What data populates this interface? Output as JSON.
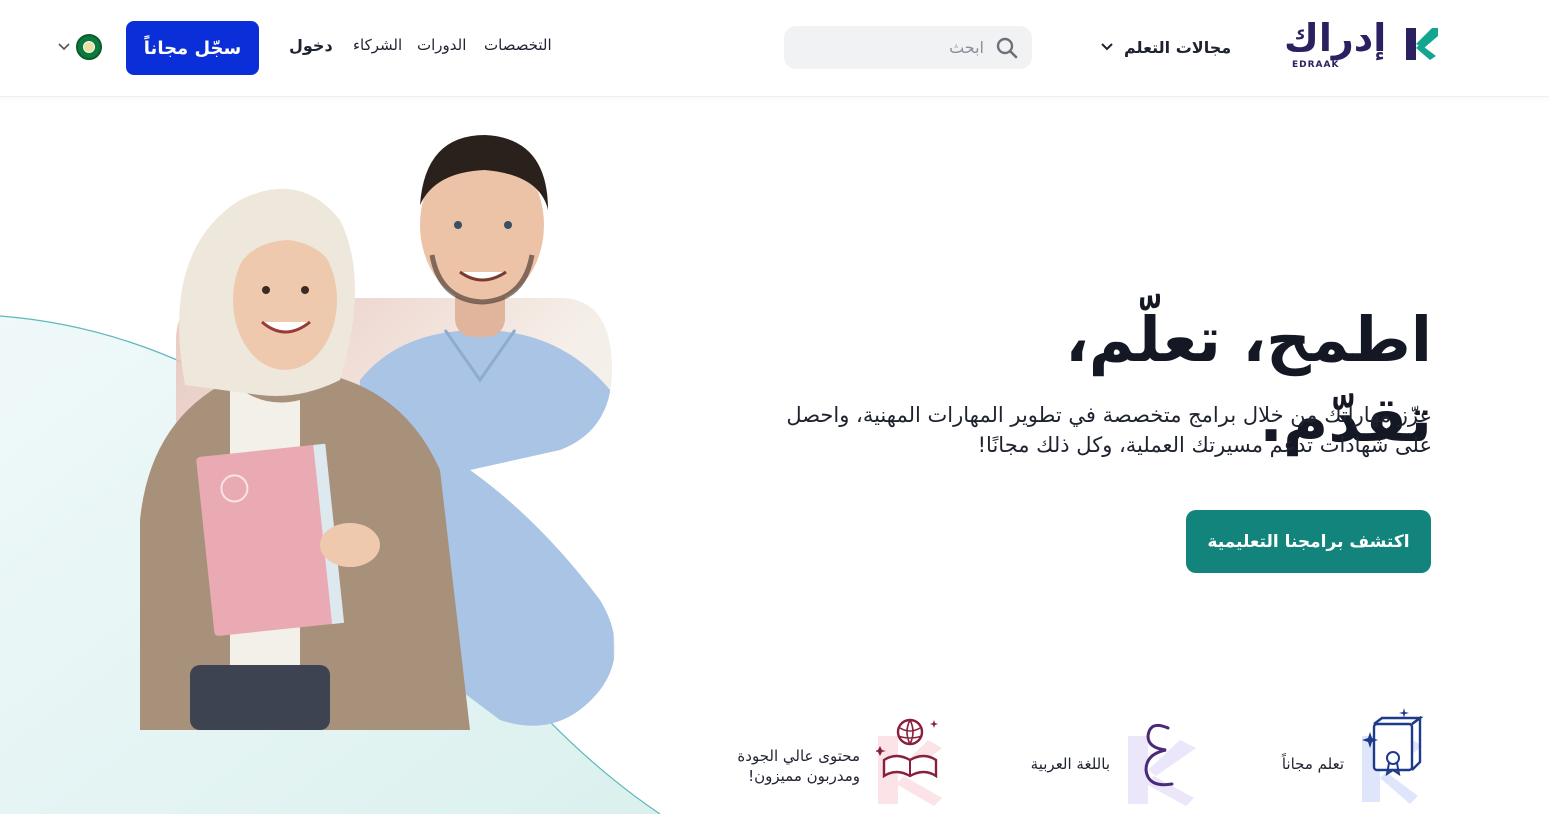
{
  "header": {
    "logo": {
      "arabic": "إدراك",
      "latin": "EDRAAK"
    },
    "learning_areas_label": "مجالات التعلم",
    "search": {
      "placeholder": "ابحث"
    },
    "nav": {
      "specializations": "التخصصات",
      "courses": "الدورات",
      "partners": "الشركاء"
    },
    "login_label": "دخول",
    "signup_label": "سجّل مجاناً"
  },
  "hero": {
    "headline": "اطمح، تعلّم، تقدّم.",
    "subline_1": "عزّز مهاراتك من خلال برامج متخصصة في تطوير المهارات المهنية، واحصل",
    "subline_2": "على شهادات تدعم مسيرتك العملية، وكل ذلك مجانًا!",
    "cta_label": "اكتشف برامجنا التعليمية"
  },
  "features": [
    {
      "label": "تعلم مجاناً",
      "icon": "book-certificate-icon"
    },
    {
      "label": "باللغة العربية",
      "icon": "arabic-letter-icon"
    },
    {
      "label_1": "محتوى عالي الجودة",
      "label_2": "ومدربون مميزون!",
      "icon": "globe-book-icon"
    }
  ],
  "colors": {
    "brand_navy": "#2b2060",
    "brand_teal": "#12847c",
    "signup_blue": "#0a2fd8",
    "flag_green": "#0c7a3c"
  }
}
